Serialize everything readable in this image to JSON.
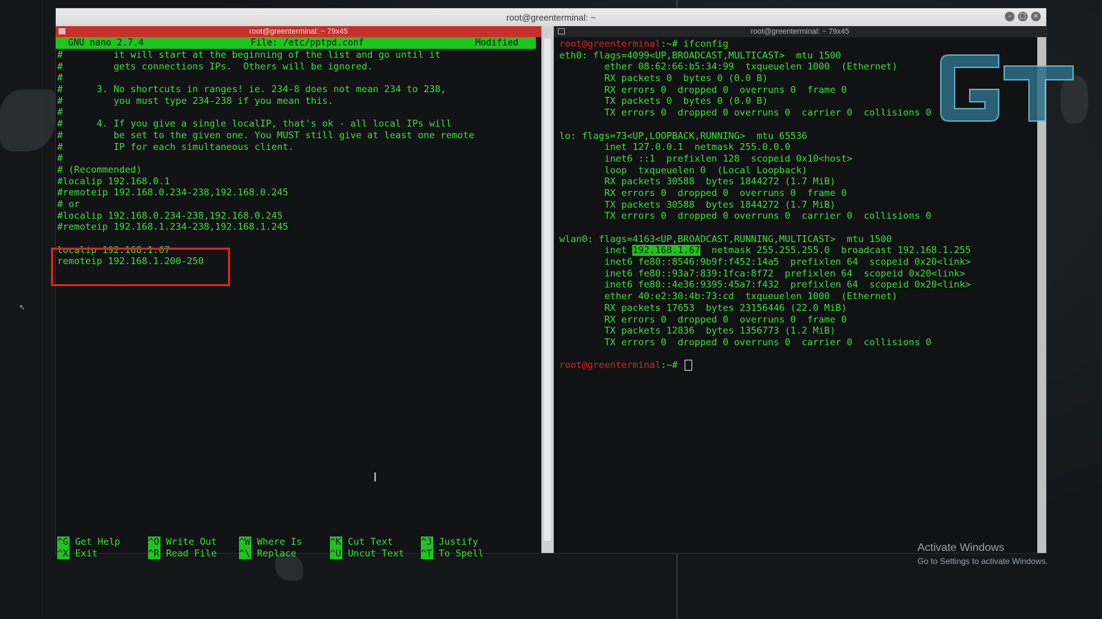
{
  "window": {
    "title": "root@greenterminal: ~"
  },
  "left_pane": {
    "title": "root@greenterminal: ~ 79x45",
    "nano": {
      "version": "GNU nano 2.7.4",
      "file": "File: /etc/pptpd.conf",
      "status": "Modified"
    },
    "lines": [
      "#         it will start at the beginning of the list and go until it",
      "#         gets connections IPs.  Others will be ignored.",
      "#",
      "#      3. No shortcuts in ranges! ie. 234-8 does not mean 234 to 238,",
      "#         you must type 234-238 if you mean this.",
      "#",
      "#      4. If you give a single localIP, that's ok - all local IPs will",
      "#         be set to the given one. You MUST still give at least one remote",
      "#         IP for each simultaneous client.",
      "#",
      "# (Recommended)",
      "#localip 192.168.0.1",
      "#remoteip 192.168.0.234-238,192.168.0.245",
      "# or",
      "#localip 192.168.0.234-238,192.168.0.245",
      "#remoteip 192.168.1.234-238,192.168.1.245",
      "",
      "localip 192.168.1.67",
      "remoteip 192.168.1.200-250"
    ],
    "shortcuts_row1": [
      {
        "key": "^G",
        "label": "Get Help"
      },
      {
        "key": "^O",
        "label": "Write Out"
      },
      {
        "key": "^W",
        "label": "Where Is"
      },
      {
        "key": "^K",
        "label": "Cut Text"
      },
      {
        "key": "^J",
        "label": "Justify"
      }
    ],
    "shortcuts_row2": [
      {
        "key": "^X",
        "label": "Exit"
      },
      {
        "key": "^R",
        "label": "Read File"
      },
      {
        "key": "^\\",
        "label": "Replace"
      },
      {
        "key": "^U",
        "label": "Uncut Text"
      },
      {
        "key": "^T",
        "label": "To Spell"
      }
    ]
  },
  "right_pane": {
    "title": "root@greenterminal: ~ 79x45",
    "prompt_user": "root@greenterminal",
    "prompt_suffix": ":~# ",
    "command": "ifconfig",
    "output": [
      "eth0: flags=4099<UP,BROADCAST,MULTICAST>  mtu 1500",
      "        ether 08:62:66:b5:34:99  txqueuelen 1000  (Ethernet)",
      "        RX packets 0  bytes 0 (0.0 B)",
      "        RX errors 0  dropped 0  overruns 0  frame 0",
      "        TX packets 0  bytes 0 (0.0 B)",
      "        TX errors 0  dropped 0 overruns 0  carrier 0  collisions 0",
      "",
      "lo: flags=73<UP,LOOPBACK,RUNNING>  mtu 65536",
      "        inet 127.0.0.1  netmask 255.0.0.0",
      "        inet6 ::1  prefixlen 128  scopeid 0x10<host>",
      "        loop  txqueuelen 0  (Local Loopback)",
      "        RX packets 30588  bytes 1844272 (1.7 MiB)",
      "        RX errors 0  dropped 0  overruns 0  frame 0",
      "        TX packets 30588  bytes 1844272 (1.7 MiB)",
      "        TX errors 0  dropped 0 overruns 0  carrier 0  collisions 0",
      "",
      "wlan0: flags=4163<UP,BROADCAST,RUNNING,MULTICAST>  mtu 1500"
    ],
    "wlan_inet_prefix": "        inet ",
    "wlan_inet_ip": "192.168.1.67",
    "wlan_inet_suffix": "  netmask 255.255.255.0  broadcast 192.168.1.255",
    "output2": [
      "        inet6 fe80::8546:9b9f:f452:14a5  prefixlen 64  scopeid 0x20<link>",
      "        inet6 fe80::93a7:839:1fca:8f72  prefixlen 64  scopeid 0x20<link>",
      "        inet6 fe80::4e36:9395:45a7:f432  prefixlen 64  scopeid 0x20<link>",
      "        ether 40:e2:30:4b:73:cd  txqueuelen 1000  (Ethernet)",
      "        RX packets 17653  bytes 23156446 (22.0 MiB)",
      "        RX errors 0  dropped 0  overruns 0  frame 0",
      "        TX packets 12836  bytes 1356773 (1.2 MiB)",
      "        TX errors 0  dropped 0 overruns 0  carrier 0  collisions 0",
      ""
    ]
  },
  "watermark": {
    "title": "Activate Windows",
    "subtitle": "Go to Settings to activate Windows."
  },
  "colors": {
    "terminal_green": "#3ae23a",
    "nano_header_green": "#1ec51e",
    "prompt_red": "#e0231f",
    "highlight_box": "#e0231f"
  },
  "icons": {
    "window_controls": [
      "minimize-icon",
      "maximize-icon",
      "close-icon"
    ],
    "logo": "gt-logo-icon"
  }
}
